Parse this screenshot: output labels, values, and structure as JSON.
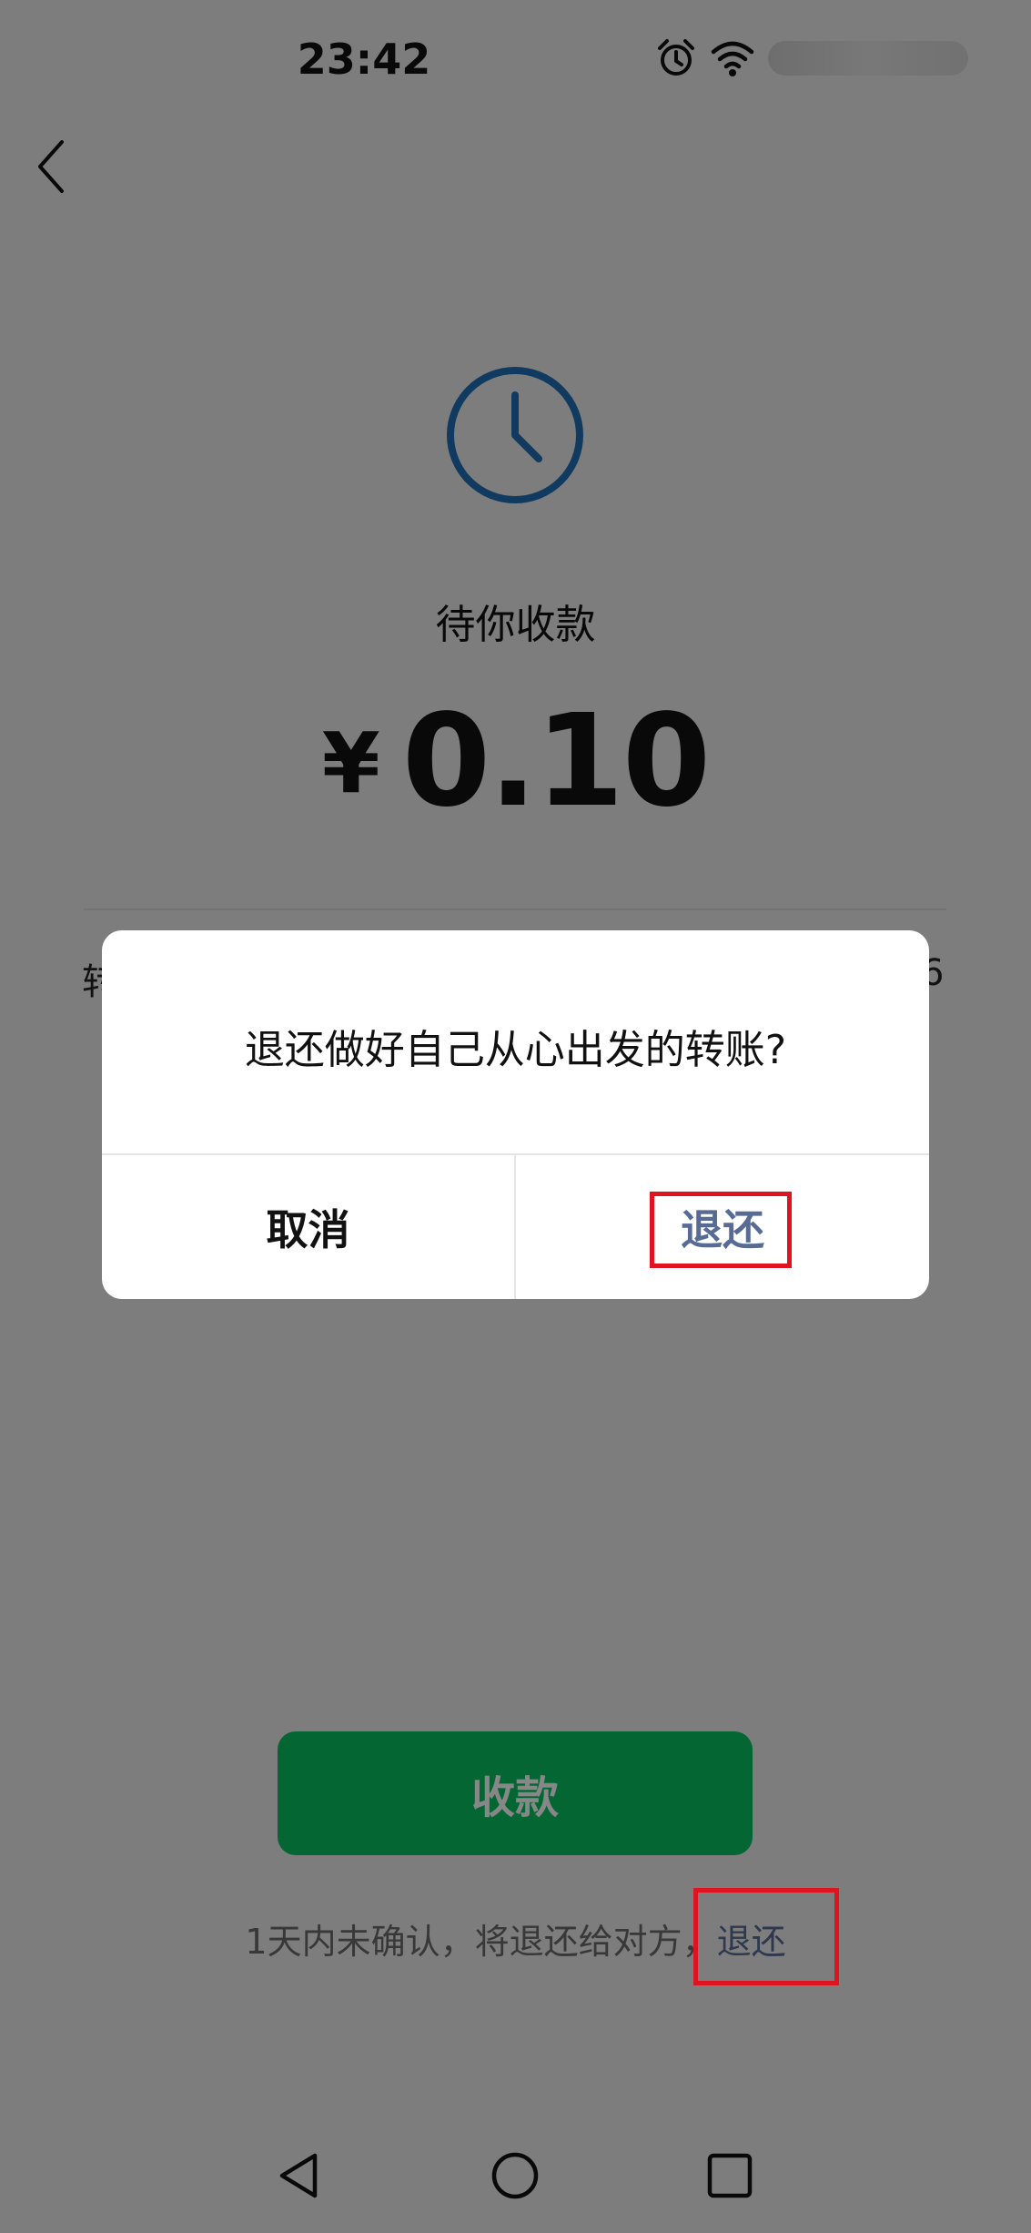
{
  "status_bar": {
    "time": "23:42",
    "icons": [
      "alarm-icon",
      "wifi-icon"
    ]
  },
  "transfer": {
    "status": "待你收款",
    "currency": "¥",
    "amount": "0.10",
    "detail_left_fragment": "转",
    "detail_right_fragment": "6",
    "receive_label": "收款",
    "hint_text": "1天内未确认，将退还给对方，",
    "hint_link": "退还"
  },
  "dialog": {
    "title": "退还做好自己从心出发的转账?",
    "cancel_label": "取消",
    "confirm_label": "退还"
  },
  "colors": {
    "brand_green": "#07c160",
    "link_blue": "#576b95",
    "clock_blue": "#1f6fb5",
    "annotation_red": "#e0141e"
  },
  "nav_bar": {
    "icons": [
      "back-triangle-icon",
      "home-circle-icon",
      "recents-square-icon"
    ]
  }
}
